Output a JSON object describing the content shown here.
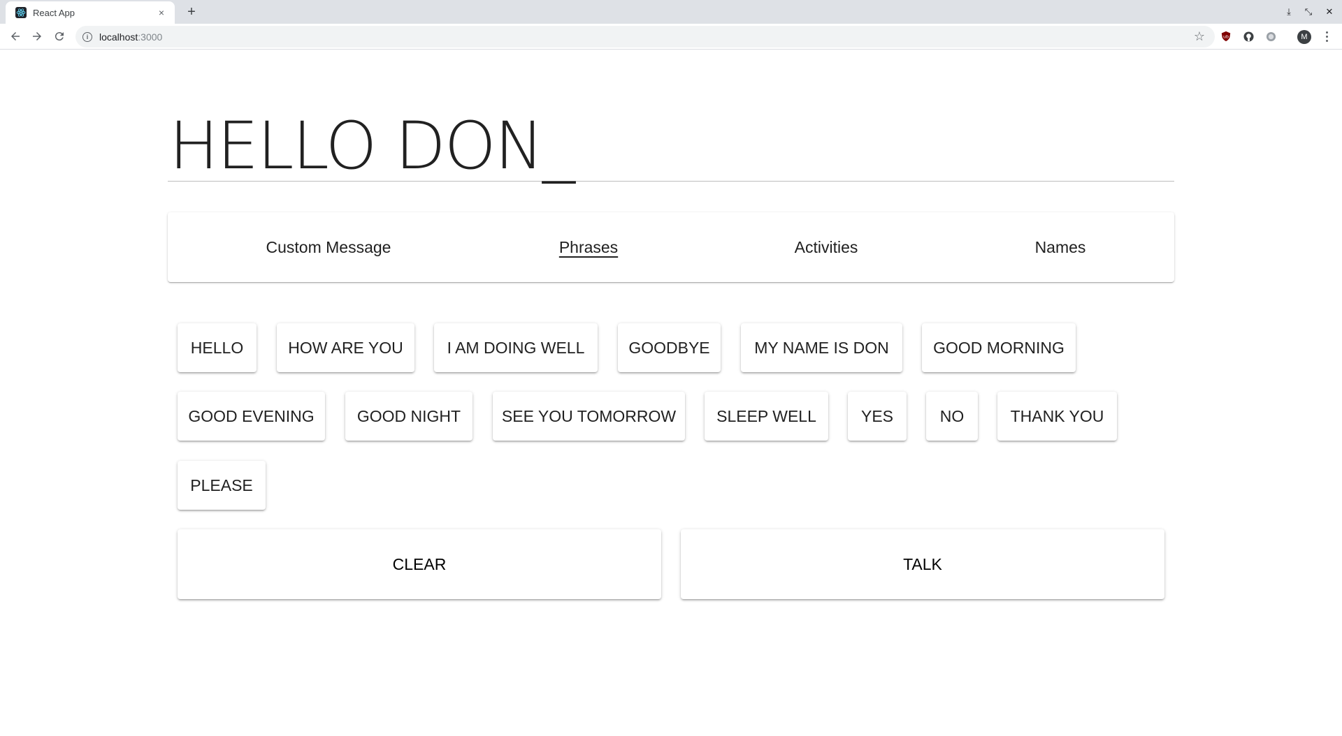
{
  "browser": {
    "tab_title": "React App",
    "tab_close": "×",
    "new_tab": "+",
    "url_host": "localhost",
    "url_port": ":3000",
    "avatar_letter": "M",
    "accent": "#4285f4"
  },
  "app": {
    "message": "HELLO DON_",
    "tabs": [
      {
        "label": "Custom Message",
        "active": false
      },
      {
        "label": "Phrases",
        "active": true
      },
      {
        "label": "Activities",
        "active": false
      },
      {
        "label": "Names",
        "active": false
      }
    ],
    "phrases": [
      "HELLO",
      "HOW ARE YOU",
      "I AM DOING WELL",
      "GOODBYE",
      "MY NAME IS DON",
      "GOOD MORNING",
      "GOOD EVENING",
      "GOOD NIGHT",
      "SEE YOU TOMORROW",
      "SLEEP WELL",
      "YES",
      "NO",
      "THANK YOU",
      "PLEASE"
    ],
    "actions": {
      "clear_label": "CLEAR",
      "talk_label": "TALK"
    }
  }
}
